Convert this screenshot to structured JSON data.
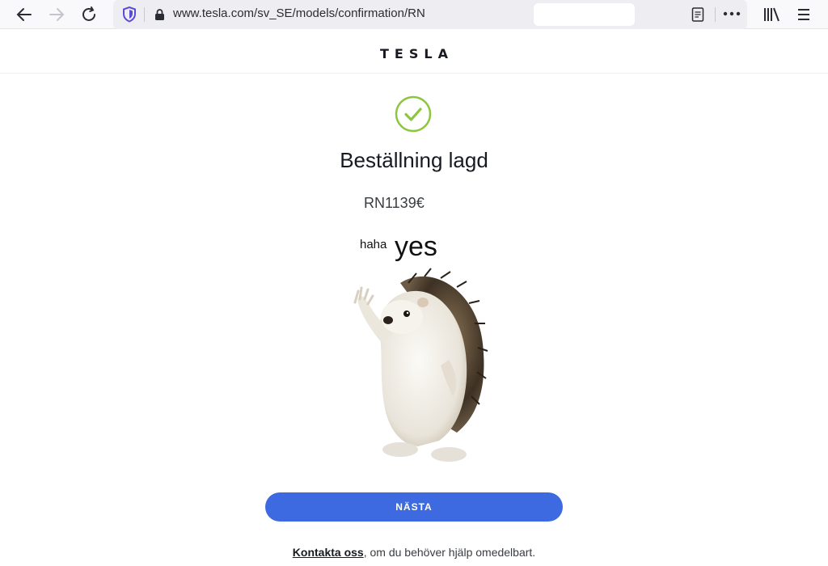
{
  "browser": {
    "url": "www.tesla.com/sv_SE/models/confirmation/RN",
    "icons": [
      "back-arrow-icon",
      "forward-arrow-icon",
      "reload-icon",
      "shield-icon",
      "lock-icon",
      "reader-view-icon",
      "more-icon",
      "library-icon",
      "menu-icon"
    ]
  },
  "header": {
    "logo": "TESLA"
  },
  "confirmation": {
    "title": "Beställning lagd",
    "order_number": "RN1139€",
    "status_color": "#8cc63f"
  },
  "meme": {
    "small_text": "haha",
    "big_text": "yes"
  },
  "actions": {
    "next_label": "NÄSTA",
    "button_color": "#3e6ae1"
  },
  "footer": {
    "contact_link": "Kontakta oss",
    "contact_suffix": ", om du behöver hjälp omedelbart."
  }
}
